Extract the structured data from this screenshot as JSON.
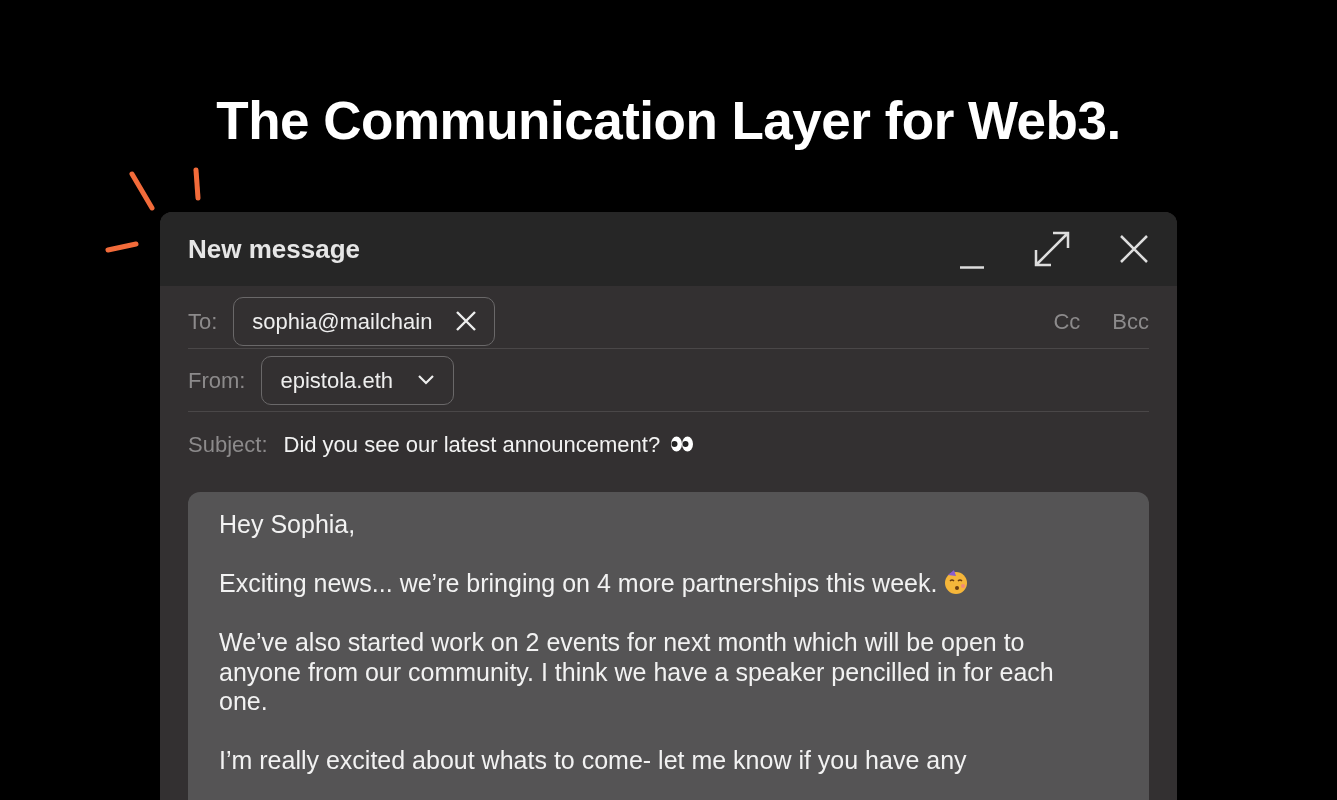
{
  "headline": "The Communication Layer for Web3.",
  "window": {
    "title": "New message"
  },
  "to": {
    "label": "To:",
    "recipient": "sophia@mailchain",
    "cc": "Cc",
    "bcc": "Bcc"
  },
  "from": {
    "label": "From:",
    "value": "epistola.eth"
  },
  "subject": {
    "label": "Subject:",
    "value": "Did you see our latest announcement?",
    "emoji": true
  },
  "body": [
    {
      "text": "Hey Sophia,",
      "emoji": false
    },
    {
      "text": "Exciting news... we’re bringing on 4 more partnerships this week.",
      "emoji": true
    },
    {
      "text": "We’ve also started work on 2 events for next month which will be open to anyone from our community. I think we have a speaker pencilled in for each one.",
      "emoji": false
    },
    {
      "text": "I’m really excited about whats to come- let me know if you have any",
      "emoji": false
    }
  ]
}
